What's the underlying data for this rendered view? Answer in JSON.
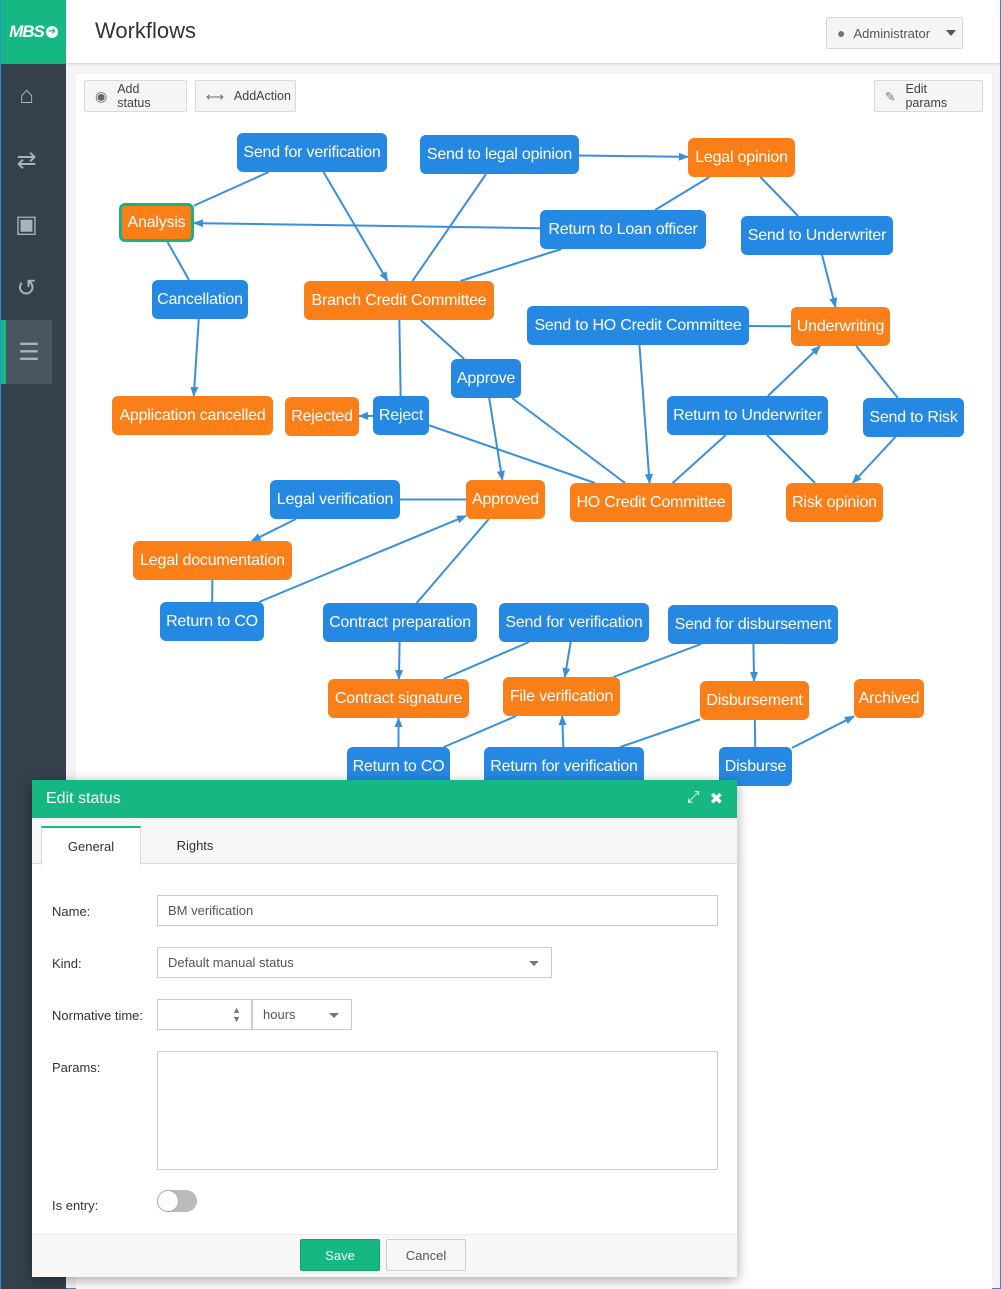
{
  "app": {
    "logo_text": "MBS",
    "logo_icon": "arrow-right-circle-icon"
  },
  "header": {
    "title": "Workflows",
    "user_label": "Administrator"
  },
  "sidebar": {
    "items": [
      {
        "name": "home",
        "icon": "home-icon",
        "glyph": "⌂",
        "active": false
      },
      {
        "name": "transfers",
        "icon": "arrows-exchange-icon",
        "glyph": "⇄",
        "active": false
      },
      {
        "name": "portfolio",
        "icon": "briefcase-icon",
        "glyph": "▣",
        "active": false
      },
      {
        "name": "history",
        "icon": "history-icon",
        "glyph": "↺",
        "active": false
      },
      {
        "name": "settings",
        "icon": "sliders-icon",
        "glyph": "☰",
        "active": true
      }
    ]
  },
  "toolbar": {
    "add_status": "Add status",
    "add_action": "AddAction",
    "edit_params": "Edit params"
  },
  "colors": {
    "brand": "#15b883",
    "action": "#2589e3",
    "status": "#fa7f18",
    "edge": "#3a8fdc"
  },
  "diagram": {
    "nodes": [
      {
        "id": "n1",
        "label": "Send for verification",
        "kind": "action"
      },
      {
        "id": "n2",
        "label": "Send to legal opinion",
        "kind": "action"
      },
      {
        "id": "n3",
        "label": "Legal opinion",
        "kind": "status"
      },
      {
        "id": "n4",
        "label": "Analysis",
        "kind": "status",
        "selected": true
      },
      {
        "id": "n5",
        "label": "Return to Loan officer",
        "kind": "action"
      },
      {
        "id": "n6",
        "label": "Send to Underwriter",
        "kind": "action"
      },
      {
        "id": "n7",
        "label": "Cancellation",
        "kind": "action"
      },
      {
        "id": "n8",
        "label": "Branch Credit Committee",
        "kind": "status"
      },
      {
        "id": "n9",
        "label": "Send to HO Credit Committee",
        "kind": "action"
      },
      {
        "id": "n10",
        "label": "Underwriting",
        "kind": "status"
      },
      {
        "id": "n11",
        "label": "Approve",
        "kind": "action"
      },
      {
        "id": "n12",
        "label": "Application cancelled",
        "kind": "status"
      },
      {
        "id": "n13",
        "label": "Rejected",
        "kind": "status"
      },
      {
        "id": "n14",
        "label": "Reject",
        "kind": "action"
      },
      {
        "id": "n15",
        "label": "Return to Underwriter",
        "kind": "action"
      },
      {
        "id": "n16",
        "label": "Send to Risk",
        "kind": "action"
      },
      {
        "id": "n17",
        "label": "Legal verification",
        "kind": "action"
      },
      {
        "id": "n18",
        "label": "Approved",
        "kind": "status"
      },
      {
        "id": "n19",
        "label": "HO Credit Committee",
        "kind": "status"
      },
      {
        "id": "n20",
        "label": "Risk opinion",
        "kind": "status"
      },
      {
        "id": "n21",
        "label": "Legal documentation",
        "kind": "status"
      },
      {
        "id": "n22",
        "label": "Return to CO",
        "kind": "action"
      },
      {
        "id": "n23",
        "label": "Contract preparation",
        "kind": "action"
      },
      {
        "id": "n24",
        "label": "Send for verification",
        "kind": "action"
      },
      {
        "id": "n25",
        "label": "Send for disbursement",
        "kind": "action"
      },
      {
        "id": "n26",
        "label": "Contract signature",
        "kind": "status"
      },
      {
        "id": "n27",
        "label": "File verification",
        "kind": "status"
      },
      {
        "id": "n28",
        "label": "Disbursement",
        "kind": "status"
      },
      {
        "id": "n29",
        "label": "Archived",
        "kind": "status"
      },
      {
        "id": "n30",
        "label": "Return to CO",
        "kind": "action"
      },
      {
        "id": "n31",
        "label": "Return for verification",
        "kind": "action"
      },
      {
        "id": "n32",
        "label": "Disburse",
        "kind": "action"
      }
    ],
    "edges": [
      {
        "from": "n4",
        "to": "n1"
      },
      {
        "from": "n1",
        "to": "n8",
        "arrow": true
      },
      {
        "from": "n8",
        "to": "n2"
      },
      {
        "from": "n2",
        "to": "n3",
        "arrow": true
      },
      {
        "from": "n3",
        "to": "n5"
      },
      {
        "from": "n5",
        "to": "n4",
        "arrow": true
      },
      {
        "from": "n8",
        "to": "n5"
      },
      {
        "from": "n3",
        "to": "n6"
      },
      {
        "from": "n6",
        "to": "n10",
        "arrow": true
      },
      {
        "from": "n4",
        "to": "n7"
      },
      {
        "from": "n7",
        "to": "n12",
        "arrow": true
      },
      {
        "from": "n8",
        "to": "n14"
      },
      {
        "from": "n14",
        "to": "n13",
        "arrow": true
      },
      {
        "from": "n8",
        "to": "n11"
      },
      {
        "from": "n11",
        "to": "n18",
        "arrow": true
      },
      {
        "from": "n11",
        "to": "n19"
      },
      {
        "from": "n14",
        "to": "n19"
      },
      {
        "from": "n10",
        "to": "n9"
      },
      {
        "from": "n9",
        "to": "n19",
        "arrow": true
      },
      {
        "from": "n19",
        "to": "n15"
      },
      {
        "from": "n15",
        "to": "n10",
        "arrow": true
      },
      {
        "from": "n20",
        "to": "n15"
      },
      {
        "from": "n10",
        "to": "n16"
      },
      {
        "from": "n16",
        "to": "n20",
        "arrow": true
      },
      {
        "from": "n18",
        "to": "n17"
      },
      {
        "from": "n17",
        "to": "n21",
        "arrow": true
      },
      {
        "from": "n21",
        "to": "n22"
      },
      {
        "from": "n22",
        "to": "n18",
        "arrow": true
      },
      {
        "from": "n18",
        "to": "n23"
      },
      {
        "from": "n23",
        "to": "n26",
        "arrow": true
      },
      {
        "from": "n26",
        "to": "n24"
      },
      {
        "from": "n24",
        "to": "n27",
        "arrow": true
      },
      {
        "from": "n27",
        "to": "n25"
      },
      {
        "from": "n25",
        "to": "n28",
        "arrow": true
      },
      {
        "from": "n27",
        "to": "n30"
      },
      {
        "from": "n30",
        "to": "n26",
        "arrow": true
      },
      {
        "from": "n28",
        "to": "n31"
      },
      {
        "from": "n31",
        "to": "n27",
        "arrow": true
      },
      {
        "from": "n28",
        "to": "n32"
      },
      {
        "from": "n32",
        "to": "n29",
        "arrow": true
      }
    ]
  },
  "modal": {
    "title": "Edit status",
    "tabs": [
      {
        "label": "General",
        "active": true
      },
      {
        "label": "Rights",
        "active": false
      }
    ],
    "fields": {
      "name_label": "Name:",
      "name_value": "BM verification",
      "kind_label": "Kind:",
      "kind_value": "Default manual status",
      "time_label": "Normative time:",
      "time_value": "",
      "time_unit": "hours",
      "params_label": "Params:",
      "params_value": "",
      "entry_label": "Is entry:",
      "entry_value": false
    },
    "save": "Save",
    "cancel": "Cancel"
  }
}
